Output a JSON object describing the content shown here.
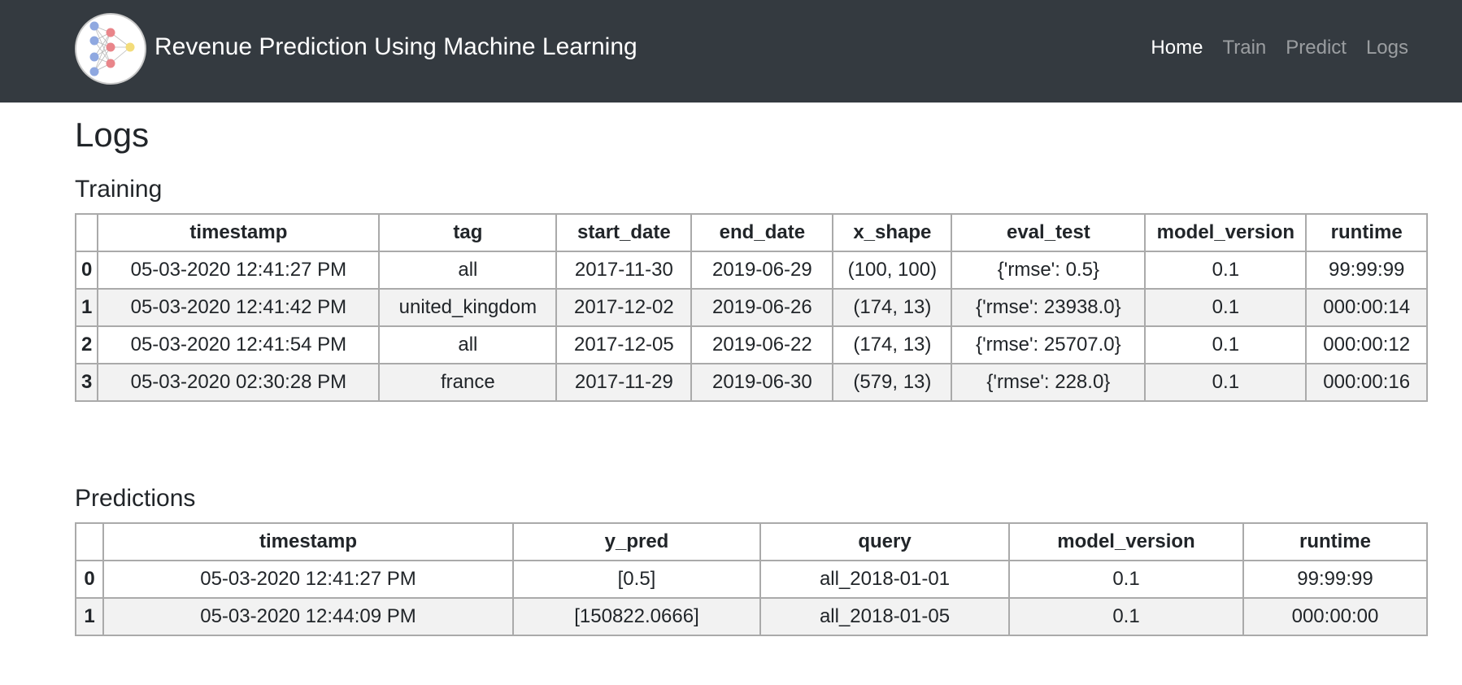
{
  "navbar": {
    "brand": "Revenue Prediction Using Machine Learning",
    "links": [
      "Home",
      "Train",
      "Predict",
      "Logs"
    ],
    "active": "Home",
    "logo_icon": "neural-network-icon",
    "colors": {
      "background": "#343a40",
      "active_link": "#ffffff",
      "inactive_link": "#8c8f93"
    }
  },
  "page": {
    "title": "Logs"
  },
  "training": {
    "heading": "Training",
    "columns": [
      "",
      "timestamp",
      "tag",
      "start_date",
      "end_date",
      "x_shape",
      "eval_test",
      "model_version",
      "runtime"
    ],
    "rows": [
      [
        "0",
        "05-03-2020 12:41:27 PM",
        "all",
        "2017-11-30",
        "2019-06-29",
        "(100, 100)",
        "{'rmse': 0.5}",
        "0.1",
        "99:99:99"
      ],
      [
        "1",
        "05-03-2020 12:41:42 PM",
        "united_kingdom",
        "2017-12-02",
        "2019-06-26",
        "(174, 13)",
        "{'rmse': 23938.0}",
        "0.1",
        "000:00:14"
      ],
      [
        "2",
        "05-03-2020 12:41:54 PM",
        "all",
        "2017-12-05",
        "2019-06-22",
        "(174, 13)",
        "{'rmse': 25707.0}",
        "0.1",
        "000:00:12"
      ],
      [
        "3",
        "05-03-2020 02:30:28 PM",
        "france",
        "2017-11-29",
        "2019-06-30",
        "(579, 13)",
        "{'rmse': 228.0}",
        "0.1",
        "000:00:16"
      ]
    ]
  },
  "predictions": {
    "heading": "Predictions",
    "columns": [
      "",
      "timestamp",
      "y_pred",
      "query",
      "model_version",
      "runtime"
    ],
    "rows": [
      [
        "0",
        "05-03-2020 12:41:27 PM",
        "[0.5]",
        "all_2018-01-01",
        "0.1",
        "99:99:99"
      ],
      [
        "1",
        "05-03-2020 12:44:09 PM",
        "[150822.0666]",
        "all_2018-01-05",
        "0.1",
        "000:00:00"
      ]
    ]
  }
}
